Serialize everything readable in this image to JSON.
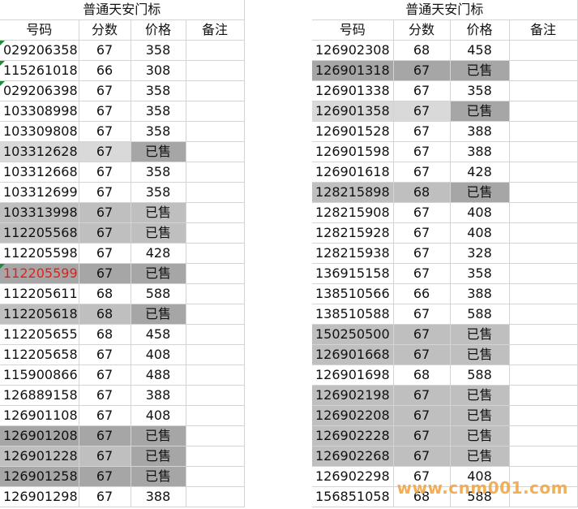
{
  "left": {
    "title": "普通天安门标",
    "headers": [
      "号码",
      "分数",
      "价格",
      "备注"
    ],
    "rows": [
      {
        "n": "029206358",
        "s": "67",
        "p": "358",
        "bg": "",
        "bgp": "",
        "mark": true,
        "red": ""
      },
      {
        "n": "115261018",
        "s": "66",
        "p": "308",
        "bg": "",
        "bgp": "",
        "mark": true,
        "red": ""
      },
      {
        "n": "029206398",
        "s": "67",
        "p": "358",
        "bg": "",
        "bgp": "",
        "mark": true,
        "red": ""
      },
      {
        "n": "103308998",
        "s": "67",
        "p": "358",
        "bg": "",
        "bgp": "",
        "mark": false,
        "red": ""
      },
      {
        "n": "103309808",
        "s": "67",
        "p": "358",
        "bg": "",
        "bgp": "",
        "mark": false,
        "red": ""
      },
      {
        "n": "103312628",
        "s": "67",
        "p": "已售",
        "bg": "#d9d9d9",
        "bgp": "#a6a6a6",
        "mark": false,
        "red": ""
      },
      {
        "n": "103312668",
        "s": "67",
        "p": "358",
        "bg": "",
        "bgp": "",
        "mark": false,
        "red": ""
      },
      {
        "n": "103312699",
        "s": "67",
        "p": "358",
        "bg": "",
        "bgp": "",
        "mark": false,
        "red": ""
      },
      {
        "n": "103313998",
        "s": "67",
        "p": "已售",
        "bg": "#bfbfbf",
        "bgp": "#bfbfbf",
        "mark": false,
        "red": ""
      },
      {
        "n": "112205568",
        "s": "67",
        "p": "已售",
        "bg": "#bfbfbf",
        "bgp": "#bfbfbf",
        "mark": false,
        "red": ""
      },
      {
        "n": "112205598",
        "s": "67",
        "p": "428",
        "bg": "",
        "bgp": "",
        "mark": false,
        "red": ""
      },
      {
        "n": "112205599",
        "s": "67",
        "p": "已售",
        "bg": "#a6a6a6",
        "bgp": "#a6a6a6",
        "mark": true,
        "red": "112205599"
      },
      {
        "n": "112205611",
        "s": "68",
        "p": "588",
        "bg": "",
        "bgp": "",
        "mark": false,
        "red": ""
      },
      {
        "n": "112205618",
        "s": "68",
        "p": "已售",
        "bg": "#bfbfbf",
        "bgp": "#a6a6a6",
        "mark": false,
        "red": ""
      },
      {
        "n": "112205655",
        "s": "68",
        "p": "458",
        "bg": "",
        "bgp": "",
        "mark": false,
        "red": ""
      },
      {
        "n": "112205658",
        "s": "67",
        "p": "408",
        "bg": "",
        "bgp": "",
        "mark": false,
        "red": ""
      },
      {
        "n": "115900866",
        "s": "67",
        "p": "488",
        "bg": "",
        "bgp": "",
        "mark": false,
        "red": ""
      },
      {
        "n": "126889158",
        "s": "67",
        "p": "388",
        "bg": "",
        "bgp": "",
        "mark": false,
        "red": ""
      },
      {
        "n": "126901108",
        "s": "67",
        "p": "408",
        "bg": "",
        "bgp": "",
        "mark": false,
        "red": ""
      },
      {
        "n": "126901208",
        "s": "67",
        "p": "已售",
        "bg": "#a6a6a6",
        "bgp": "#a6a6a6",
        "mark": false,
        "red": ""
      },
      {
        "n": "126901228",
        "s": "67",
        "p": "已售",
        "bg": "#bfbfbf",
        "bgp": "#a6a6a6",
        "mark": false,
        "red": ""
      },
      {
        "n": "126901258",
        "s": "67",
        "p": "已售",
        "bg": "#a6a6a6",
        "bgp": "#a6a6a6",
        "mark": false,
        "red": ""
      },
      {
        "n": "126901298",
        "s": "67",
        "p": "388",
        "bg": "",
        "bgp": "",
        "mark": false,
        "red": ""
      }
    ]
  },
  "right": {
    "title": "普通天安门标",
    "headers": [
      "号码",
      "分数",
      "价格",
      "备注"
    ],
    "rows": [
      {
        "n": "126902308",
        "s": "68",
        "p": "458",
        "bg": "",
        "bgp": ""
      },
      {
        "n": "126901318",
        "s": "67",
        "p": "已售",
        "bg": "#a6a6a6",
        "bgp": "#a6a6a6"
      },
      {
        "n": "126901338",
        "s": "67",
        "p": "358",
        "bg": "",
        "bgp": ""
      },
      {
        "n": "126901358",
        "s": "67",
        "p": "已售",
        "bg": "#d9d9d9",
        "bgp": "#a6a6a6"
      },
      {
        "n": "126901528",
        "s": "67",
        "p": "388",
        "bg": "",
        "bgp": ""
      },
      {
        "n": "126901598",
        "s": "67",
        "p": "388",
        "bg": "",
        "bgp": ""
      },
      {
        "n": "126901618",
        "s": "67",
        "p": "428",
        "bg": "",
        "bgp": ""
      },
      {
        "n": "128215898",
        "s": "68",
        "p": "已售",
        "bg": "#bfbfbf",
        "bgp": "#a6a6a6"
      },
      {
        "n": "128215908",
        "s": "67",
        "p": "408",
        "bg": "",
        "bgp": ""
      },
      {
        "n": "128215928",
        "s": "67",
        "p": "408",
        "bg": "",
        "bgp": ""
      },
      {
        "n": "128215938",
        "s": "67",
        "p": "328",
        "bg": "",
        "bgp": ""
      },
      {
        "n": "136915158",
        "s": "67",
        "p": "358",
        "bg": "",
        "bgp": ""
      },
      {
        "n": "138510566",
        "s": "66",
        "p": "388",
        "bg": "",
        "bgp": ""
      },
      {
        "n": "138510588",
        "s": "67",
        "p": "588",
        "bg": "",
        "bgp": ""
      },
      {
        "n": "150250500",
        "s": "67",
        "p": "已售",
        "bg": "#bfbfbf",
        "bgp": "#bfbfbf"
      },
      {
        "n": "126901668",
        "s": "67",
        "p": "已售",
        "bg": "#bfbfbf",
        "bgp": "#bfbfbf"
      },
      {
        "n": "126901698",
        "s": "68",
        "p": "588",
        "bg": "",
        "bgp": ""
      },
      {
        "n": "126902198",
        "s": "67",
        "p": "已售",
        "bg": "#bfbfbf",
        "bgp": "#bfbfbf"
      },
      {
        "n": "126902208",
        "s": "67",
        "p": "已售",
        "bg": "#bfbfbf",
        "bgp": "#bfbfbf"
      },
      {
        "n": "126902228",
        "s": "67",
        "p": "已售",
        "bg": "#bfbfbf",
        "bgp": "#bfbfbf"
      },
      {
        "n": "126902268",
        "s": "67",
        "p": "已售",
        "bg": "#bfbfbf",
        "bgp": "#bfbfbf"
      },
      {
        "n": "126902298",
        "s": "67",
        "p": "408",
        "bg": "",
        "bgp": ""
      },
      {
        "n": "156851058",
        "s": "68",
        "p": "588",
        "bg": "",
        "bgp": ""
      }
    ]
  },
  "watermark": "www.cnm001.com"
}
